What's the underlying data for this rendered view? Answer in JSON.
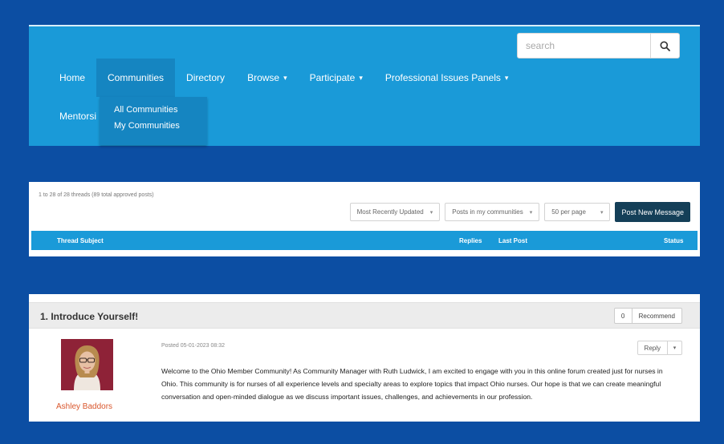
{
  "nav": {
    "search_placeholder": "search",
    "items": [
      {
        "label": "Home",
        "caret": ""
      },
      {
        "label": "Communities",
        "caret": ""
      },
      {
        "label": "Directory",
        "caret": ""
      },
      {
        "label": "Browse",
        "caret": "▾"
      },
      {
        "label": "Participate",
        "caret": "▾"
      },
      {
        "label": "Professional Issues Panels",
        "caret": "▾"
      }
    ],
    "row2_item": "Mentorsi",
    "dropdown": [
      "All Communities",
      "My Communities"
    ]
  },
  "threads": {
    "count_text": "1 to 28 of 28 threads (89 total approved posts)",
    "sort": "Most Recently Updated",
    "filter": "Posts in my communities",
    "per_page": "50 per page",
    "post_button": "Post New Message",
    "columns": {
      "subject": "Thread Subject",
      "replies": "Replies",
      "last_post": "Last Post",
      "status": "Status"
    }
  },
  "post": {
    "title": "1.  Introduce Yourself!",
    "recommend_count": "0",
    "recommend_label": "Recommend",
    "posted": "Posted 05-01-2023 08:32",
    "reply_label": "Reply",
    "author": "Ashley Baddors",
    "body": "Welcome to the Ohio Member Community! As Community Manager with Ruth Ludwick, I am excited to engage with you in this online forum created just for nurses in Ohio. This community is for nurses of all experience levels and specialty areas to explore topics that impact Ohio nurses. Our hope is that we can create meaningful conversation and open-minded dialogue as we discuss important issues, challenges, and achievements in our profession."
  },
  "colors": {
    "background": "#0c4ea3",
    "nav_blue": "#1a9ad8",
    "nav_active": "#1585c1",
    "post_button": "#143f58",
    "author_link": "#d9562c"
  },
  "icons": [
    "search-icon",
    "chevron-down-icon"
  ]
}
